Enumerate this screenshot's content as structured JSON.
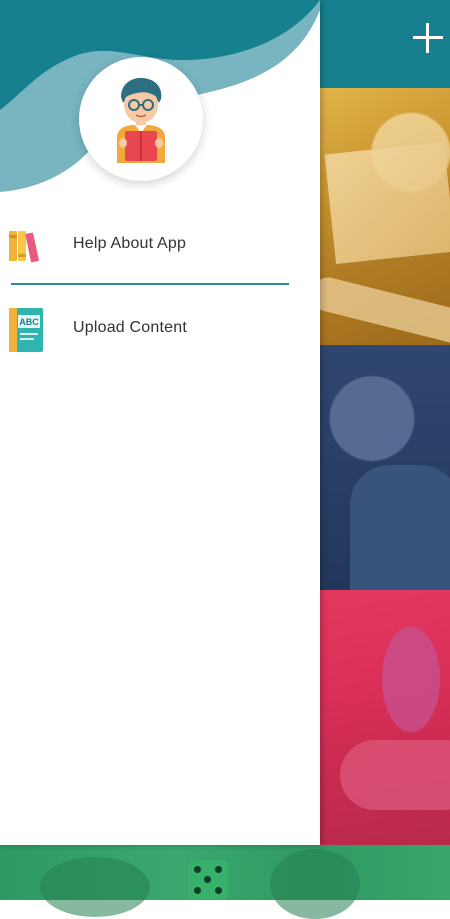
{
  "toolbar": {
    "add_icon": "plus-icon",
    "color": "#17808e"
  },
  "drawer": {
    "avatar_icon": "teacher-avatar-icon",
    "items": [
      {
        "label": "Help About App",
        "icon": "books-icon"
      },
      {
        "label": "Upload Content",
        "icon": "abc-book-icon"
      }
    ],
    "accent": "#2f8c98"
  },
  "content": {
    "cards": [
      {
        "name": "craft-photo",
        "tint": "#c99530"
      },
      {
        "name": "child-photo",
        "tint": "#2a3f66"
      },
      {
        "name": "painting-photo",
        "tint": "#d92f58"
      }
    ],
    "bottom_tint": "#3aa86e"
  }
}
